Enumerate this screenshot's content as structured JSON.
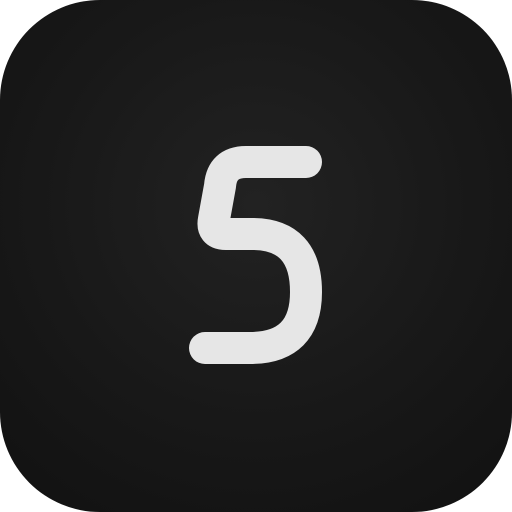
{
  "icon": {
    "numeral": "5",
    "background_color": "#161616",
    "glyph_color": "#e6e6e6",
    "glyph_icon": "digit-five-icon"
  }
}
